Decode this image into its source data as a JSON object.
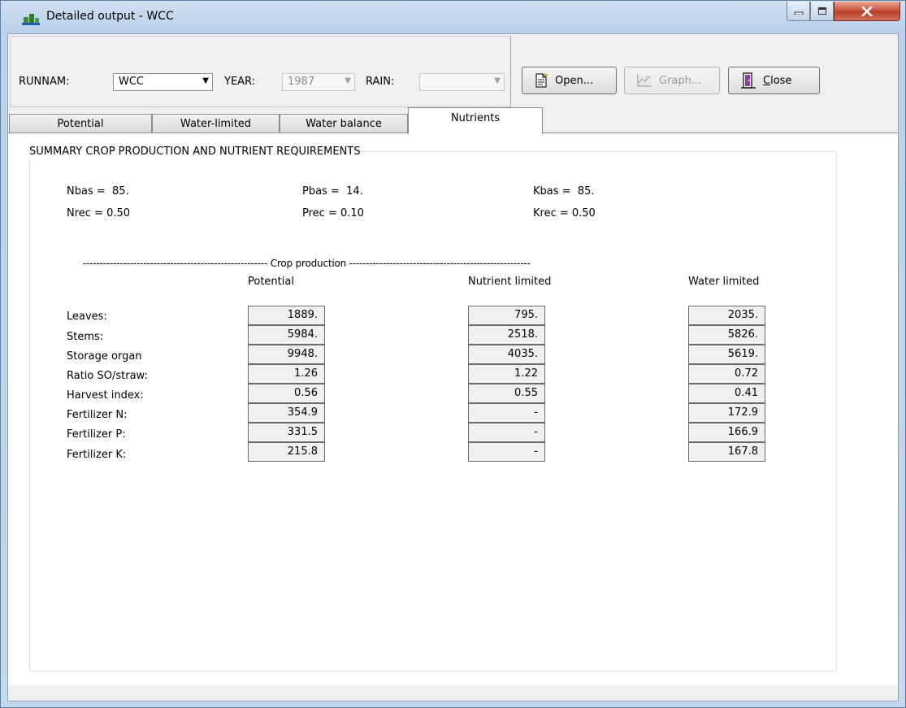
{
  "window": {
    "title": "Detailed output - WCC"
  },
  "toolbar": {
    "runnam_label": "RUNNAM:",
    "runnam_value": "WCC",
    "year_label": "YEAR:",
    "year_value": "1987",
    "rain_label": "RAIN:",
    "rain_value": "",
    "open_label": "Open...",
    "graph_label": "Graph...",
    "close_label": "Close"
  },
  "tabs": [
    {
      "label": "Potential"
    },
    {
      "label": "Water-limited"
    },
    {
      "label": "Water balance"
    },
    {
      "label": "Nutrients"
    }
  ],
  "summary": {
    "caption": "SUMMARY CROP PRODUCTION AND NUTRIENT REQUIREMENTS",
    "nbas": "Nbas =  85.",
    "pbas": "Pbas =  14.",
    "kbas": "Kbas =  85.",
    "nrec": "Nrec = 0.50",
    "prec": "Prec = 0.10",
    "krec": "Krec = 0.50",
    "separator": "------------------------------------------------------- Crop production ------------------------------------------------------",
    "columns": [
      "Potential",
      "Nutrient limited",
      "Water limited"
    ],
    "rows": [
      {
        "label": "Leaves:",
        "values": [
          "1889.",
          "795.",
          "2035."
        ]
      },
      {
        "label": "Stems:",
        "values": [
          "5984.",
          "2518.",
          "5826."
        ]
      },
      {
        "label": "Storage organ",
        "values": [
          "9948.",
          "4035.",
          "5619."
        ]
      },
      {
        "label": "Ratio SO/straw:",
        "values": [
          "1.26",
          "1.22",
          "0.72"
        ]
      },
      {
        "label": "Harvest index:",
        "values": [
          "0.56",
          "0.55",
          "0.41"
        ]
      },
      {
        "label": "Fertilizer N:",
        "values": [
          "354.9",
          "-",
          "172.9"
        ]
      },
      {
        "label": "Fertilizer P:",
        "values": [
          "331.5",
          "-",
          "166.9"
        ]
      },
      {
        "label": "Fertilizer K:",
        "values": [
          "215.8",
          "-",
          "167.8"
        ]
      }
    ]
  },
  "icons": {
    "app": "app-icon",
    "open": "document-icon",
    "graph": "graph-icon",
    "close": "door-icon"
  },
  "colors": {
    "titlebar": "#b9d1ea",
    "close_button": "#c7503b"
  }
}
